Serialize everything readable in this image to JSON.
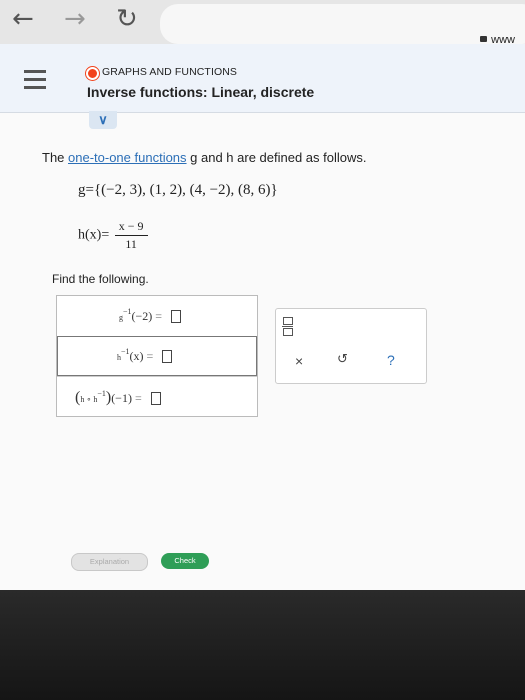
{
  "browser": {
    "back_icon": "arrow-left-icon",
    "forward_icon": "arrow-right-icon",
    "reload_icon": "reload-icon",
    "url": "www"
  },
  "header": {
    "topic": "GRAPHS AND FUNCTIONS",
    "title": "Inverse functions: Linear, discrete",
    "topic_color": "#f2431c"
  },
  "problem": {
    "intro_before": "The ",
    "intro_link": "one-to-one functions",
    "intro_after": " g and h are defined as follows.",
    "g_definition": "g={(−2, 3), (1, 2), (4, −2), (8, 6)}",
    "h_lhs": "h(x)=",
    "h_numerator": "x − 9",
    "h_denominator": "11",
    "find_label": "Find the following."
  },
  "answers": [
    {
      "func": "g",
      "sup": "−1",
      "arg": "(−2)",
      "eq": "="
    },
    {
      "func": "h",
      "sup": "−1",
      "arg": "(x)",
      "eq": "="
    },
    {
      "lparen": "(",
      "inner": "h ∘ h",
      "inner_sup": "−1",
      "rparen": ")",
      "arg": "(−1)",
      "eq": "="
    }
  ],
  "tools": {
    "clear": "×",
    "undo": "↺",
    "help": "?"
  },
  "buttons": {
    "explanation": "Explanation",
    "check": "Check"
  },
  "colors": {
    "link": "#2c6fb7",
    "check_button": "#2f9e57"
  }
}
